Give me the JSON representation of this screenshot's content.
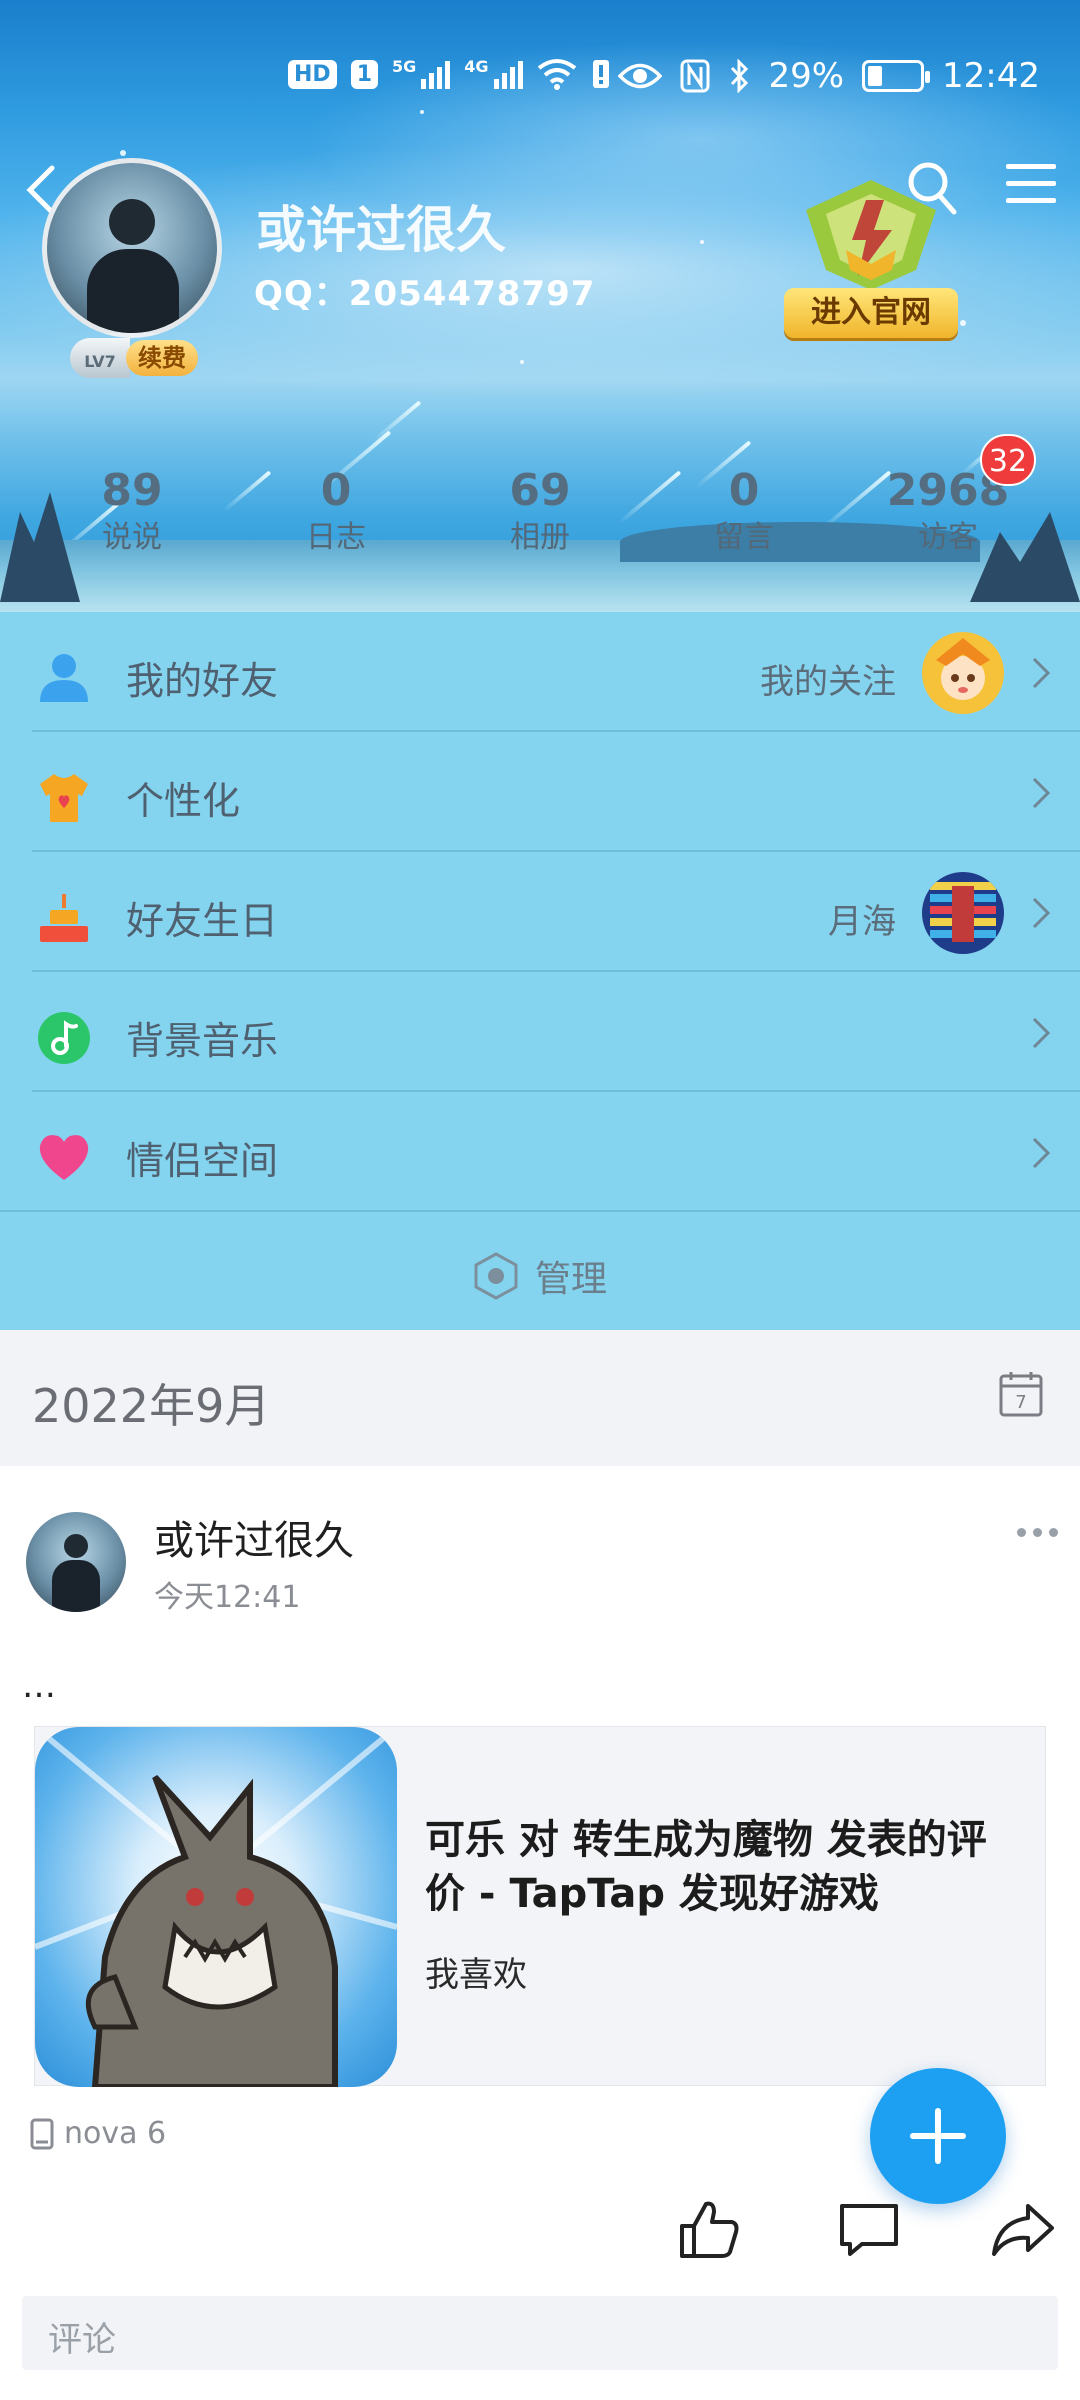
{
  "status_bar": {
    "left_chips": [
      "HD",
      "1"
    ],
    "signal_1_label": "5G",
    "signal_2_label": "4G",
    "battery_percent": "29%",
    "battery_level": 0.29,
    "time": "12:42"
  },
  "profile": {
    "nickname": "或许过很久",
    "qq": "QQ：2054478797",
    "level": "LV7",
    "renew_label": "续费",
    "official_site_label": "进入官网"
  },
  "stats": [
    {
      "value": "89",
      "label": "说说"
    },
    {
      "value": "0",
      "label": "日志"
    },
    {
      "value": "69",
      "label": "相册"
    },
    {
      "value": "0",
      "label": "留言"
    },
    {
      "value": "2968",
      "label": "访客"
    }
  ],
  "visitor_badge": "32",
  "menu": [
    {
      "label": "我的好友",
      "side": "我的关注",
      "icon": "person-icon"
    },
    {
      "label": "个性化",
      "side": "",
      "icon": "tshirt-icon"
    },
    {
      "label": "好友生日",
      "side": "月海",
      "icon": "cake-icon"
    },
    {
      "label": "背景音乐",
      "side": "",
      "icon": "music-note-icon"
    },
    {
      "label": "情侣空间",
      "side": "",
      "icon": "heart-icon"
    }
  ],
  "manage_label": "管理",
  "feed": {
    "month": "2022年9月",
    "calendar_day": "7"
  },
  "post": {
    "author": "或许过很久",
    "time": "今天12:41",
    "text": "…",
    "share_title": "可乐 对 转生成为魔物 发表的评价 - TapTap 发现好游戏",
    "share_subtitle": "我喜欢",
    "device": "nova 6",
    "comment_placeholder": "评论"
  },
  "colors": {
    "accent": "#1ea0f2",
    "menu_bg": "#85d4ef",
    "badge_red": "#ef3b3b"
  }
}
